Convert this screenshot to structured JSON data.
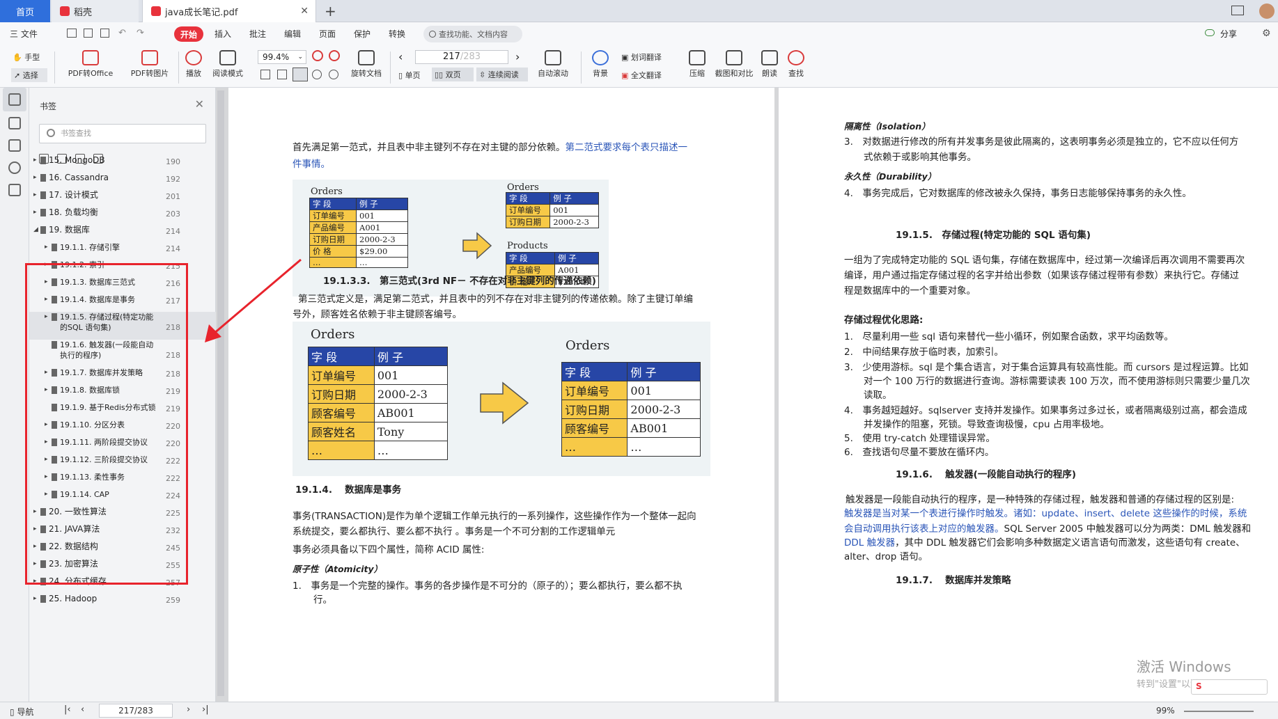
{
  "tabs": {
    "home": "首页",
    "daoke": "稻壳",
    "pdf": "java成长笔记.pdf"
  },
  "menu": {
    "file": "三 文件",
    "start": "开始",
    "items": [
      "插入",
      "批注",
      "编辑",
      "页面",
      "保护",
      "转换"
    ],
    "search": "查找功能、文档内容",
    "share": "分享"
  },
  "toolbar": {
    "hand": "手型",
    "select": "选择",
    "pdf_office": "PDF转Office",
    "pdf_img": "PDF转图片",
    "play": "播放",
    "read_mode": "阅读模式",
    "zoom": "99.4%",
    "rotate": "旋转文档",
    "page_current": "217",
    "page_total": "/283",
    "single": "单页",
    "double": "双页",
    "continuous": "连续阅读",
    "auto_scroll": "自动滚动",
    "background": "背景",
    "word_translate": "划词翻译",
    "full_translate": "全文翻译",
    "compress": "压缩",
    "screenshot": "截图和对比",
    "read_aloud": "朗读",
    "find": "查找"
  },
  "panel": {
    "title": "书签",
    "search_placeholder": "书签查找",
    "bookmarks": [
      {
        "label": "15. MongoDB",
        "page": "190"
      },
      {
        "label": "16. Cassandra",
        "page": "192"
      },
      {
        "label": "17. 设计模式",
        "page": "201"
      },
      {
        "label": "18. 负载均衡",
        "page": "203"
      },
      {
        "label": "19. 数据库",
        "page": "214"
      },
      {
        "label": "19.1.1. 存储引擎",
        "page": "214"
      },
      {
        "label": "19.1.2. 索引",
        "page": "215"
      },
      {
        "label": "19.1.3. 数据库三范式",
        "page": "216"
      },
      {
        "label": "19.1.4. 数据库是事务",
        "page": "217"
      },
      {
        "label": "19.1.5. 存储过程(特定功能",
        "label2": "的SQL 语句集)",
        "page": "218"
      },
      {
        "label": "19.1.6. 触发器(一段能自动",
        "label2": "执行的程序)",
        "page": "218"
      },
      {
        "label": "19.1.7. 数据库并发策略",
        "page": "218"
      },
      {
        "label": "19.1.8. 数据库锁",
        "page": "219"
      },
      {
        "label": "19.1.9. 基于Redis分布式锁",
        "page": "219"
      },
      {
        "label": "19.1.10. 分区分表",
        "page": "220"
      },
      {
        "label": "19.1.11. 两阶段提交协议",
        "page": "220"
      },
      {
        "label": "19.1.12. 三阶段提交协议",
        "page": "222"
      },
      {
        "label": "19.1.13. 柔性事务",
        "page": "222"
      },
      {
        "label": "19.1.14. CAP",
        "page": "224"
      },
      {
        "label": "20. 一致性算法",
        "page": "225"
      },
      {
        "label": "21. JAVA算法",
        "page": "232"
      },
      {
        "label": "22. 数据结构",
        "page": "245"
      },
      {
        "label": "23. 加密算法",
        "page": "255"
      },
      {
        "label": "24. 分布式缓存",
        "page": "257"
      },
      {
        "label": "25. Hadoop",
        "page": "259"
      }
    ]
  },
  "page1": {
    "p1a": "首先满足第一范式，并且表中非主键列不存在对主键的部分依赖。",
    "p1b": "第二范式要求每个表只描述一",
    "p1c": "件事情。",
    "fig1": {
      "left_title": "Orders",
      "left_head": [
        "字 段",
        "例 子"
      ],
      "left_rows": [
        [
          "订单编号",
          "001"
        ],
        [
          "产品编号",
          "A001"
        ],
        [
          "订购日期",
          "2000-2-3"
        ],
        [
          "价 格",
          "$29.00"
        ],
        [
          "…",
          "…"
        ]
      ],
      "right1_title": "Orders",
      "right1_head": [
        "字 段",
        "例 子"
      ],
      "right1_rows": [
        [
          "订单编号",
          "001"
        ],
        [
          "订购日期",
          "2000-2-3"
        ]
      ],
      "right2_title": "Products",
      "right2_head": [
        "字 段",
        "例 子"
      ],
      "right2_rows": [
        [
          "产品编号",
          "A001"
        ],
        [
          "价 格",
          "$29.00"
        ]
      ]
    },
    "h3": "19.1.3.3.　第三范式(3rd NF－ 不存在对非主键列的传递依赖)",
    "p2a": "第三范式定义是，满足第二范式，并且表中的列不存在对非主键列的传递依赖。除了主键订单编",
    "p2b": "号外，顾客姓名依赖于非主键顾客编号。",
    "fig2": {
      "left_title": "Orders",
      "head": [
        "字 段",
        "例 子"
      ],
      "left_rows": [
        [
          "订单编号",
          "001"
        ],
        [
          "订购日期",
          "2000-2-3"
        ],
        [
          "顾客编号",
          "AB001"
        ],
        [
          "顾客姓名",
          "Tony"
        ],
        [
          "…",
          "…"
        ]
      ],
      "right_title": "Orders",
      "right_rows": [
        [
          "订单编号",
          "001"
        ],
        [
          "订购日期",
          "2000-2-3"
        ],
        [
          "顾客编号",
          "AB001"
        ],
        [
          "…",
          "…"
        ]
      ]
    },
    "h4": "19.1.4.　 数据库是事务",
    "p3a": "事务(TRANSACTION)是作为单个逻辑工作单元执行的一系列操作，这些操作作为一个整体一起向",
    "p3b": "系统提交，要么都执行、要么都不执行 。事务是一个不可分割的工作逻辑单元",
    "p4": "事务必须具备以下四个属性，简称 ACID 属性:",
    "atom": "原子性（Atomicity）",
    "li1a": "1.　事务是一个完整的操作。事务的各步操作是不可分的（原子的）；要么都执行，要么都不执",
    "li1b": "行。"
  },
  "page2": {
    "iso": "隔离性（Isolation）",
    "li3a": "3.　对数据进行修改的所有并发事务是彼此隔离的，这表明事务必须是独立的，它不应以任何方",
    "li3b": "式依赖于或影响其他事务。",
    "dur": "永久性（Durability）",
    "li4": "4.　事务完成后，它对数据库的修改被永久保持，事务日志能够保持事务的永久性。",
    "h5": "19.1.5.　存储过程(特定功能的 SQL 语句集)",
    "p5a": "一组为了完成特定功能的 SQL 语句集，存储在数据库中，经过第一次编译后再次调用不需要再次",
    "p5b": "编译，用户通过指定存储过程的名字并给出参数（如果该存储过程带有参数）来执行它。存储过",
    "p5c": "程是数据库中的一个重要对象。",
    "opt": "存储过程优化思路:",
    "o1": "1.　尽量利用一些 sql 语句来替代一些小循环，例如聚合函数，求平均函数等。",
    "o2": "2.　中间结果存放于临时表，加索引。",
    "o3a": "3.　少使用游标。sql 是个集合语言，对于集合运算具有较高性能。而 cursors 是过程运算。比如",
    "o3b": "对一个 100 万行的数据进行查询。游标需要读表 100 万次，而不使用游标则只需要少量几次",
    "o3c": "读取。",
    "o4a": "4.　事务越短越好。sqlserver 支持并发操作。如果事务过多过长，或者隔离级别过高，都会造成",
    "o4b": "并发操作的阻塞，死锁。导致查询极慢，cpu 占用率极地。",
    "o5": "5.　使用 try-catch 处理错误异常。",
    "o6": "6.　查找语句尽量不要放在循环内。",
    "h6": "19.1.6.　 触发器(一段能自动执行的程序)",
    "p6a1": "触发器是一段能自动执行的程序，是一种特殊的存储过程，触发器和普通的存储过程的区别是:",
    "p6b1": "触发器是当对某一个表进行操作时触发。诸如：update、insert、delete 这些操作的时候，系统",
    "p6c1": "会自动调用执行该表上对应的触发器。",
    "p6c2": "SQL Server 2005 中触发器可以分为两类：DML 触发器和",
    "p6d1": "DDL 触发器",
    "p6d2": "，其中 DDL 触发器它们会影响多种数据定义语言语句而激发，这些语句有 create、",
    "p6e": "alter、drop 语句。",
    "h7": "19.1.7.　 数据库并发策略",
    "watermark1": "激活 Windows",
    "watermark2": "转到\"设置\"以激活 Windows。"
  },
  "status": {
    "nav": "导航",
    "page": "217/283",
    "zoom": "99%"
  }
}
